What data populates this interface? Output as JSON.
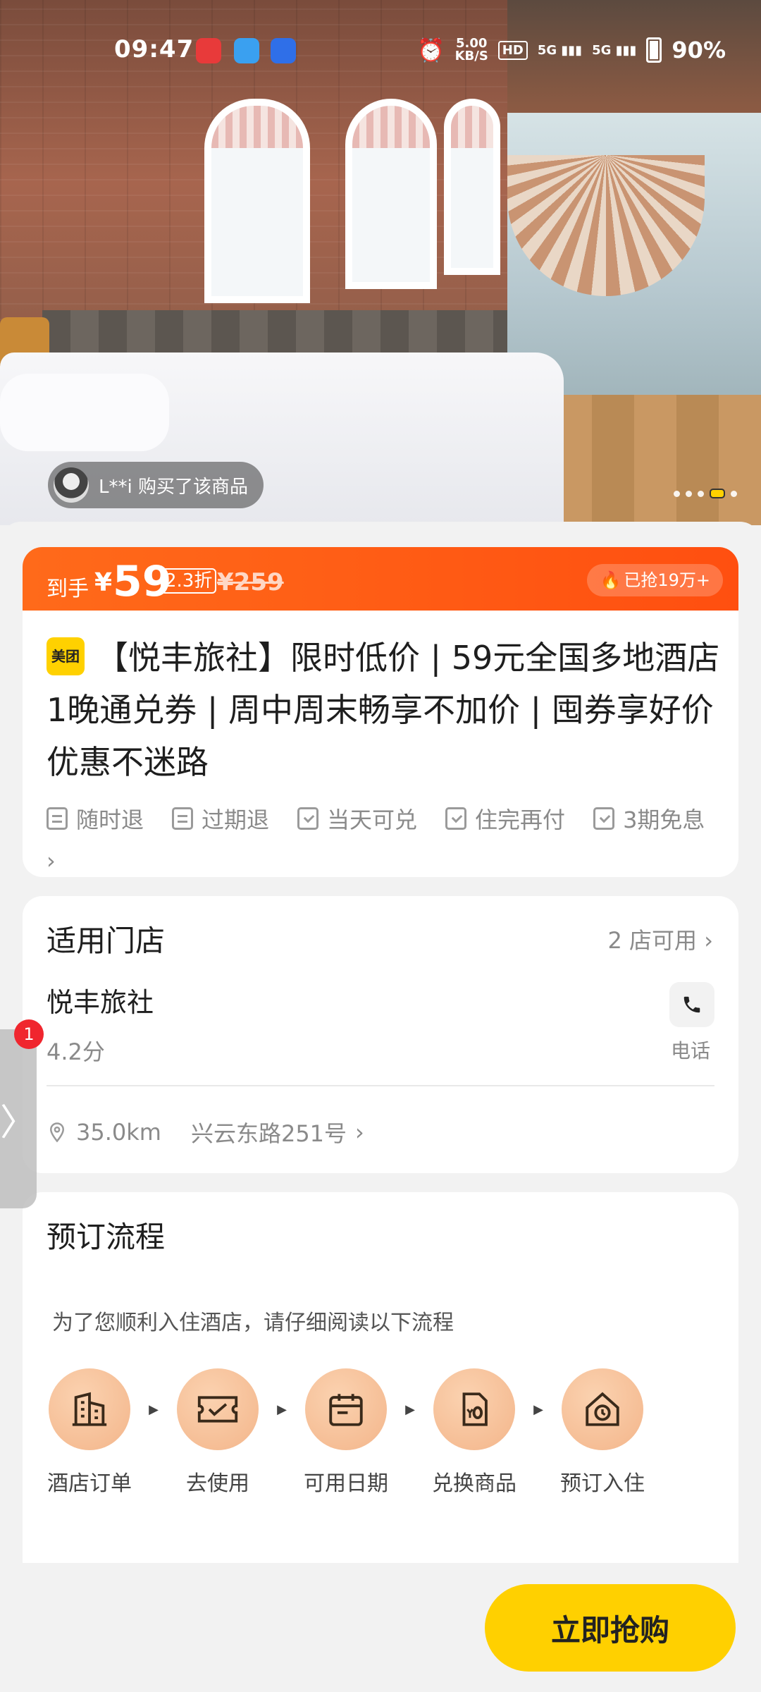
{
  "status_bar": {
    "time": "09:47",
    "net_speed_value": "5.00",
    "net_speed_unit": "KB/S",
    "hd_label": "HD",
    "signal_1": "5G",
    "signal_2": "5G",
    "battery": "90%"
  },
  "hero": {
    "buyer_text": "L**i 购买了该商品",
    "carousel_total": 4,
    "carousel_active": 3
  },
  "price_banner": {
    "label": "到手",
    "currency": "¥",
    "price": "59",
    "discount": "2.3折",
    "original_price": "¥259",
    "sold_text": "已抢19万+"
  },
  "product": {
    "brand_badge": "美团",
    "title": "【悦丰旅社】限时低价 | 59元全国多地酒店1晚通兑券 | 周中周末畅享不加价 | 囤券享好价 优惠不迷路",
    "tags": [
      "随时退",
      "过期退",
      "当天可兑",
      "住完再付",
      "3期免息"
    ],
    "more": "›"
  },
  "store": {
    "section_title": "适用门店",
    "count_text": "2 店可用",
    "name": "悦丰旅社",
    "rating": "4.2分",
    "phone_label": "电话",
    "distance": "35.0km",
    "address": "兴云东路251号"
  },
  "booking": {
    "section_title": "预订流程",
    "note": "为了您顺利入住酒店，请仔细阅读以下流程",
    "steps": [
      "酒店订单",
      "去使用",
      "可用日期",
      "兑换商品",
      "预订入住"
    ]
  },
  "footer": {
    "buy_label": "立即抢购"
  },
  "side_tab": {
    "badge": "1",
    "arrow": "〉"
  },
  "colors": {
    "banner_orange": "#ff5a14",
    "brand_yellow": "#ffd000",
    "badge_red": "#f0262e"
  }
}
